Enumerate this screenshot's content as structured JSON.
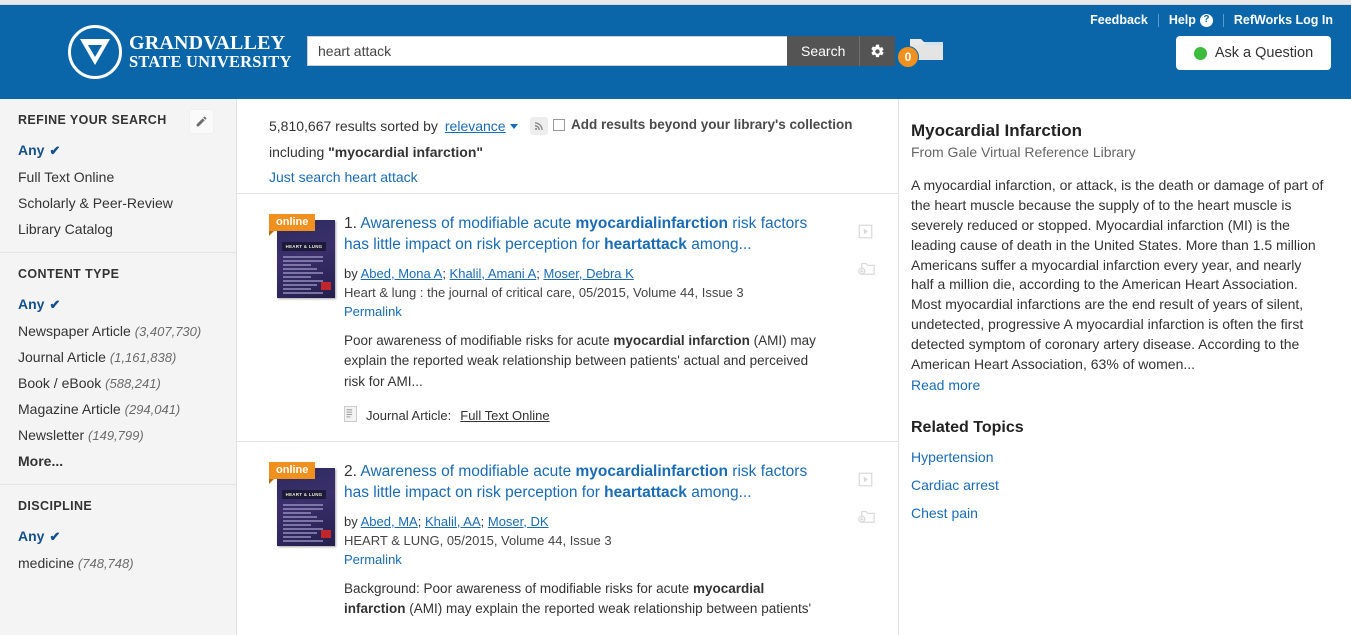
{
  "header": {
    "brand": {
      "line1_small": "G",
      "line1": "RAND",
      "line1b_small": "V",
      "line1b": "ALLEY",
      "line2_small": "S",
      "line2": "TATE",
      "line2b_small": "U",
      "line2b": "NIVERSITY",
      "full_line1": "GRANDVALLEY",
      "full_line2": "STATE UNIVERSITY"
    },
    "util": {
      "feedback": "Feedback",
      "help": "Help",
      "refworks": "RefWorks Log In"
    },
    "search": {
      "value": "heart attack",
      "placeholder": "",
      "button_label": "Search"
    },
    "folder_count": "0",
    "ask_button": "Ask a Question",
    "accent_blue": "#0a66a8",
    "accent_orange": "#f0901e",
    "accent_green": "#3dbb3d"
  },
  "sidebar": {
    "groups": [
      {
        "title": "REFINE YOUR SEARCH",
        "has_edit": true,
        "items": [
          {
            "label": "Any",
            "count": "",
            "selected": true
          },
          {
            "label": "Full Text Online",
            "count": ""
          },
          {
            "label": "Scholarly & Peer-Review",
            "count": ""
          },
          {
            "label": "Library Catalog",
            "count": ""
          }
        ]
      },
      {
        "title": "CONTENT TYPE",
        "has_edit": false,
        "items": [
          {
            "label": "Any",
            "count": "",
            "selected": true
          },
          {
            "label": "Newspaper Article",
            "count": "(3,407,730)"
          },
          {
            "label": "Journal Article",
            "count": "(1,161,838)"
          },
          {
            "label": "Book / eBook",
            "count": "(588,241)"
          },
          {
            "label": "Magazine Article",
            "count": "(294,041)"
          },
          {
            "label": "Newsletter",
            "count": "(149,799)"
          },
          {
            "label": "More...",
            "count": "",
            "more": true
          }
        ]
      },
      {
        "title": "DISCIPLINE",
        "has_edit": false,
        "items": [
          {
            "label": "Any",
            "count": "",
            "selected": true
          },
          {
            "label": "medicine",
            "count": "(748,748)"
          }
        ]
      }
    ]
  },
  "results_header": {
    "count_text": "5,810,667 results sorted by",
    "sort_value": "relevance",
    "including_prefix": "including",
    "including_term": "\"myocardial infarction\"",
    "just_search_link": "Just search heart attack",
    "beyond_label": "Add results beyond your library's collection"
  },
  "results": [
    {
      "badge": "online",
      "cover_text": "HEART & LUNG",
      "number": "1.",
      "title_parts": [
        {
          "t": "Awareness of modifiable acute ",
          "b": false
        },
        {
          "t": "myocardialinfarction",
          "b": true
        },
        {
          "t": " risk factors has little impact on risk perception for ",
          "b": false
        },
        {
          "t": "heartattack",
          "b": true
        },
        {
          "t": " among...",
          "b": false
        }
      ],
      "by_label": "by",
      "authors": [
        "Abed, Mona A",
        "Khalil, Amani A",
        "Moser, Debra K"
      ],
      "source": "Heart & lung : the journal of critical care, 05/2015, Volume 44, Issue 3",
      "permalink": "Permalink",
      "abstract_parts": [
        {
          "t": "Poor awareness of modifiable risks for acute ",
          "b": false
        },
        {
          "t": "myocardial infarction",
          "b": true
        },
        {
          "t": " (AMI) may explain the reported weak relationship between patients' actual and perceived risk for AMI...",
          "b": false
        }
      ],
      "format_label": "Journal Article:",
      "format_link": "Full Text Online"
    },
    {
      "badge": "online",
      "cover_text": "HEART & LUNG",
      "number": "2.",
      "title_parts": [
        {
          "t": "Awareness of modifiable acute ",
          "b": false
        },
        {
          "t": "myocardialinfarction",
          "b": true
        },
        {
          "t": " risk factors has little impact on risk perception for ",
          "b": false
        },
        {
          "t": "heartattack",
          "b": true
        },
        {
          "t": " among...",
          "b": false
        }
      ],
      "by_label": "by",
      "authors": [
        "Abed, MA",
        "Khalil, AA",
        "Moser, DK"
      ],
      "source": "HEART & LUNG, 05/2015, Volume 44, Issue 3",
      "permalink": "Permalink",
      "abstract_parts": [
        {
          "t": "Background: Poor awareness of modifiable risks for acute ",
          "b": false
        },
        {
          "t": "myocardial infarction",
          "b": true
        },
        {
          "t": " (AMI) may explain the reported weak relationship between patients'",
          "b": false
        }
      ],
      "format_label": "",
      "format_link": ""
    }
  ],
  "right_panel": {
    "title": "Myocardial Infarction",
    "source": "From Gale Virtual Reference Library",
    "body": "A myocardial infarction, or attack, is the death or damage of part of the heart muscle because the supply of to the heart muscle is severely reduced or stopped. Myocardial infarction (MI) is the leading cause of death in the United States. More than 1.5 million Americans suffer a myocardial infarction every year, and nearly half a million die, according to the American Heart Association. Most myocardial infarctions are the end result of years of silent, undetected, progressive A myocardial infarction is often the first detected symptom of coronary artery disease. According to the American Heart Association, 63% of women...",
    "read_more": "Read more",
    "related_title": "Related Topics",
    "related_topics": [
      "Hypertension",
      "Cardiac arrest",
      "Chest pain"
    ]
  }
}
